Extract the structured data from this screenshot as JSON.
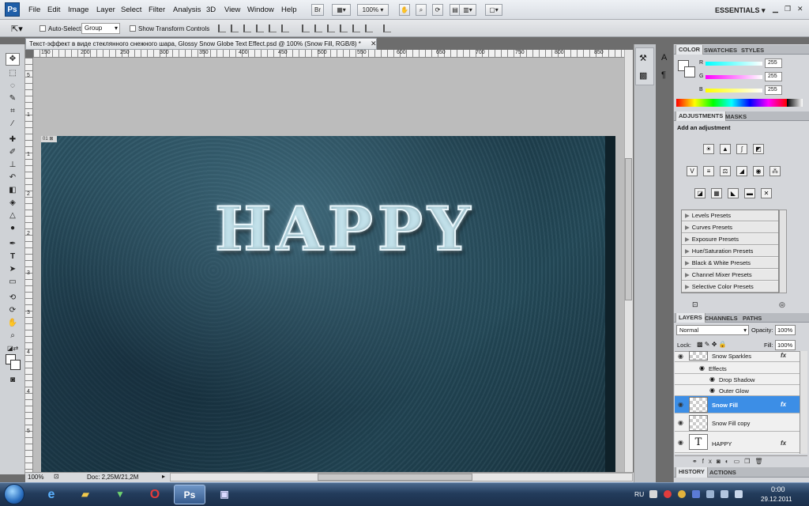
{
  "app": {
    "logo": "Ps"
  },
  "menu": [
    "File",
    "Edit",
    "Image",
    "Layer",
    "Select",
    "Filter",
    "Analysis",
    "3D",
    "View",
    "Window",
    "Help"
  ],
  "appbar": {
    "zoom": "100%",
    "workspace": "ESSENTIALS ▾"
  },
  "options": {
    "auto_select_label": "Auto-Select:",
    "auto_select_value": "Group",
    "show_transform_label": "Show Transform Controls"
  },
  "document": {
    "tab_title": "Текст-эффект в виде стеклянного снежного шара, Glossy Snow Globe Text Effect.psd @ 100% (Snow Fill, RGB/8) *",
    "canvas_text": "HAPPY",
    "ruler_h": [
      "150",
      "200",
      "250",
      "300",
      "350",
      "400",
      "450",
      "500",
      "550",
      "600",
      "650",
      "700",
      "750",
      "800",
      "850"
    ],
    "ruler_v": [
      "5",
      "1",
      "1",
      "2",
      "2",
      "3",
      "3",
      "4",
      "4",
      "5"
    ]
  },
  "status": {
    "zoom": "100%",
    "doc_info": "Doc: 2,25M/21,2M"
  },
  "color_panel": {
    "tabs": [
      "COLOR",
      "SWATCHES",
      "STYLES"
    ],
    "channels": [
      {
        "label": "R",
        "value": "255",
        "color": "#2ed2d2"
      },
      {
        "label": "G",
        "value": "255",
        "color": "#d22ed2"
      },
      {
        "label": "B",
        "value": "255",
        "color": "#d2d22e"
      }
    ]
  },
  "adjustments": {
    "tabs": [
      "ADJUSTMENTS",
      "MASKS"
    ],
    "title": "Add an adjustment",
    "presets": [
      "Levels Presets",
      "Curves Presets",
      "Exposure Presets",
      "Hue/Saturation Presets",
      "Black & White Presets",
      "Channel Mixer Presets",
      "Selective Color Presets"
    ]
  },
  "layers": {
    "tabs": [
      "LAYERS",
      "CHANNELS",
      "PATHS"
    ],
    "blend_mode": "Normal",
    "opacity_label": "Opacity:",
    "opacity": "100%",
    "lock_label": "Lock:",
    "fill_label": "Fill:",
    "fill": "100%",
    "rows": [
      {
        "name": "Snow Sparkles",
        "fx": "fx"
      },
      {
        "name": "Effects"
      },
      {
        "name": "Drop Shadow"
      },
      {
        "name": "Outer Glow"
      },
      {
        "name": "Snow Fill",
        "fx": "fx",
        "selected": true
      },
      {
        "name": "Snow Fill copy"
      },
      {
        "name": "HAPPY",
        "fx": "fx",
        "thumb": "T"
      }
    ]
  },
  "bottom_tabs": [
    "HISTORY",
    "ACTIONS"
  ],
  "taskbar": {
    "ps_label": "Ps",
    "lang": "RU",
    "time": "0:00",
    "date": "29.12.2011"
  }
}
